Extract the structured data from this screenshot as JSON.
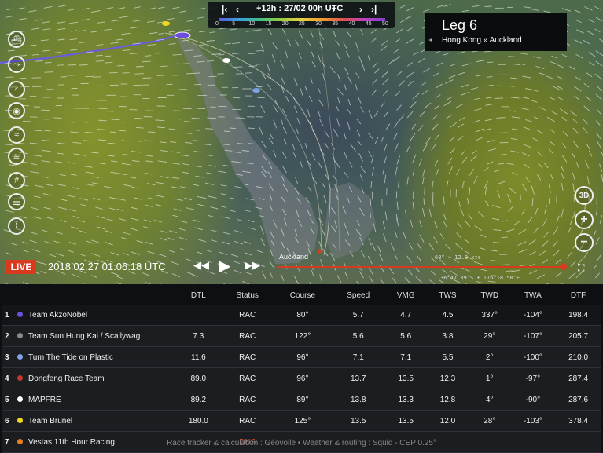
{
  "timebar": {
    "step_label": "+12h : 27/02 00h UTC",
    "scale": [
      "0",
      "5",
      "10",
      "15",
      "20",
      "25",
      "30",
      "35",
      "40",
      "45",
      "50"
    ]
  },
  "leg": {
    "title": "Leg 6",
    "subtitle": "Hong Kong » Auckland"
  },
  "status": {
    "live": "LIVE",
    "datetime": "2018.02.27 01:06:18 UTC",
    "playback_progress": 0.99
  },
  "map": {
    "destination": "Auckland",
    "wind_readout": "68° » 12.8 kts",
    "coord_readout": "36°47.39'S • 176°18.50'E"
  },
  "right_buttons": {
    "three_d": "3D"
  },
  "table": {
    "headers": [
      "",
      "",
      "DTL",
      "Status",
      "Course",
      "Speed",
      "VMG",
      "TWS",
      "TWD",
      "TWA",
      "DTF"
    ],
    "rows": [
      {
        "rank": "1",
        "team": "Team AkzoNobel",
        "color": "#6b4fd8",
        "dtl": "",
        "status": "RAC",
        "course": "80°",
        "speed": "5.7",
        "vmg": "4.7",
        "tws": "4.5",
        "twd": "337°",
        "twa": "-104°",
        "dtf": "198.4"
      },
      {
        "rank": "2",
        "team": "Team Sun Hung Kai / Scallywag",
        "color": "#8a8a8a",
        "dtl": "7.3",
        "status": "RAC",
        "course": "122°",
        "speed": "5.6",
        "vmg": "5.6",
        "tws": "3.8",
        "twd": "29°",
        "twa": "-107°",
        "dtf": "205.7"
      },
      {
        "rank": "3",
        "team": "Turn The Tide on Plastic",
        "color": "#7fa3e6",
        "dtl": "11.6",
        "status": "RAC",
        "course": "96°",
        "speed": "7.1",
        "vmg": "7.1",
        "tws": "5.5",
        "twd": "2°",
        "twa": "-100°",
        "dtf": "210.0"
      },
      {
        "rank": "4",
        "team": "Dongfeng Race Team",
        "color": "#c0392b",
        "dtl": "89.0",
        "status": "RAC",
        "course": "96°",
        "speed": "13.7",
        "vmg": "13.5",
        "tws": "12.3",
        "twd": "1°",
        "twa": "-97°",
        "dtf": "287.4"
      },
      {
        "rank": "5",
        "team": "MAPFRE",
        "color": "#ffffff",
        "dtl": "89.2",
        "status": "RAC",
        "course": "89°",
        "speed": "13.8",
        "vmg": "13.3",
        "tws": "12.8",
        "twd": "4°",
        "twa": "-90°",
        "dtf": "287.6"
      },
      {
        "rank": "6",
        "team": "Team Brunel",
        "color": "#f0d820",
        "dtl": "180.0",
        "status": "RAC",
        "course": "125°",
        "speed": "13.5",
        "vmg": "13.5",
        "tws": "12.0",
        "twd": "28°",
        "twa": "-103°",
        "dtf": "378.4"
      },
      {
        "rank": "7",
        "team": "Vestas 11th Hour Racing",
        "color": "#e67e22",
        "dtl": "",
        "status": "DNS",
        "course": "",
        "speed": "",
        "vmg": "",
        "tws": "",
        "twd": "",
        "twa": "",
        "dtf": ""
      }
    ]
  },
  "footer": "Race tracker & calculation : Géovoile • Weather & routing : Squid - CEP 0.25°"
}
